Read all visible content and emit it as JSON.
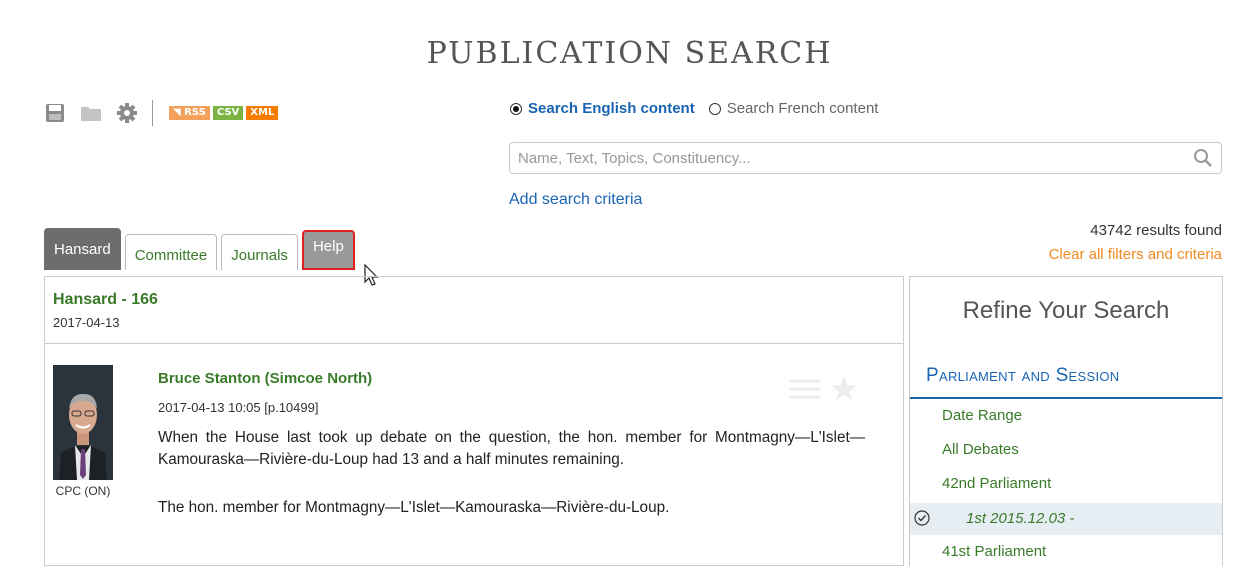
{
  "page": {
    "title": "PUBLICATION SEARCH"
  },
  "toolbar": {
    "icons": [
      "save-icon",
      "folder-icon",
      "gear-icon"
    ],
    "rss_label": "RSS",
    "csv_label": "CSV",
    "xml_label": "XML"
  },
  "search": {
    "english_label": "Search English content",
    "french_label": "Search French content",
    "selected": "english",
    "placeholder": "Name, Text, Topics, Constituency...",
    "value": "",
    "add_criteria": "Add search criteria"
  },
  "results": {
    "count_text": "43742 results found",
    "clear_text": "Clear all filters and criteria"
  },
  "tabs": [
    {
      "label": "Hansard",
      "active": true
    },
    {
      "label": "Committee",
      "active": false
    },
    {
      "label": "Journals",
      "active": false
    },
    {
      "label": "Help",
      "active": false,
      "highlighted": true
    }
  ],
  "document": {
    "title": "Hansard - 166",
    "date": "2017-04-13"
  },
  "speech": {
    "speaker": "Bruce Stanton (Simcoe North)",
    "timestamp": "2017-04-13 10:05 [p.10499]",
    "caption": "CPC (ON)",
    "paragraphs": [
      "When the House last took up debate on the question, the hon. member for Montmagny—L'Islet—Kamouraska—Rivière-du-Loup had 13 and a half minutes remaining.",
      "The hon. member for Montmagny—L'Islet—Kamouraska—Rivière-du-Loup."
    ]
  },
  "refine": {
    "title": "Refine Your Search",
    "section": "Parliament and Session",
    "items": [
      "Date Range",
      "All Debates",
      "42nd Parliament"
    ],
    "selected_item": "1st 2015.12.03 -",
    "next_item": "41st Parliament"
  },
  "colors": {
    "link_blue": "#1a64b4",
    "green": "#3a7b2a",
    "orange": "#f08a24",
    "tab_grey": "#6d6d6d"
  }
}
